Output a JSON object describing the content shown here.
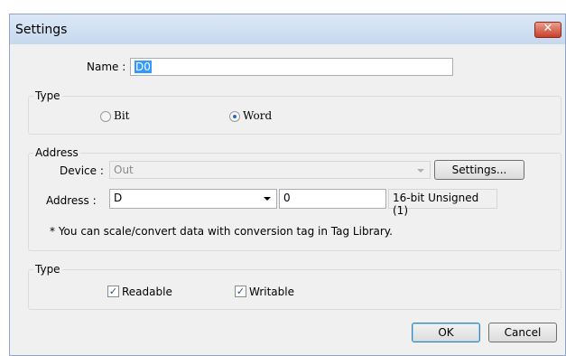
{
  "window": {
    "title": "Settings"
  },
  "name_row": {
    "label": "Name :",
    "value": "D0"
  },
  "type_group1": {
    "title": "Type",
    "options": [
      "Bit",
      "Word"
    ],
    "selected": "Word"
  },
  "address_group": {
    "title": "Address",
    "device_label": "Device :",
    "device_value": "Out",
    "settings_button": "Settings...",
    "address_label": "Address :",
    "address_select": "D",
    "address_value": "0",
    "data_format": "16-bit Unsigned (1)",
    "note": "* You can scale/convert data with conversion tag in Tag Library."
  },
  "type_group2": {
    "title": "Type",
    "readable_label": "Readable",
    "readable_checked": true,
    "writable_label": "Writable",
    "writable_checked": true
  },
  "buttons": {
    "ok": "OK",
    "cancel": "Cancel"
  }
}
